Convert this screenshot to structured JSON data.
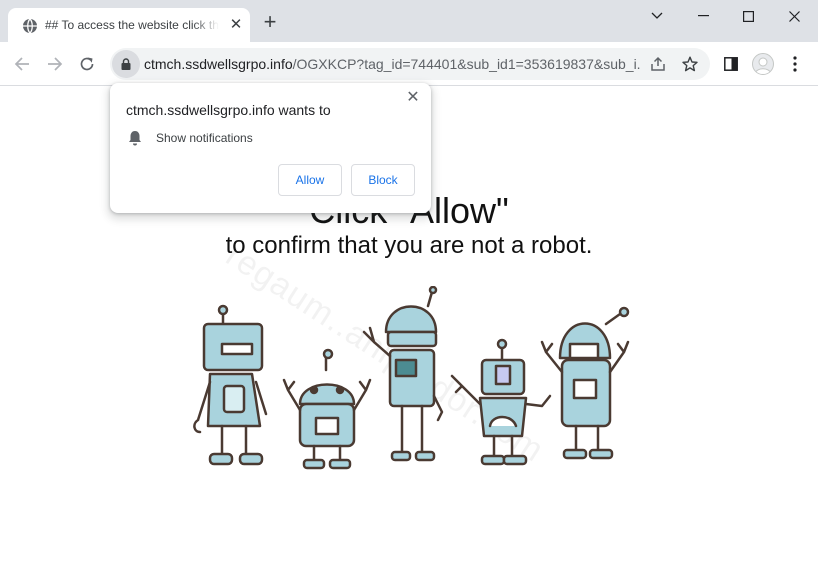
{
  "browser": {
    "tab": {
      "title": "## To access the website click the \"Allow\" button"
    },
    "new_tab_label": "+",
    "tab_close_label": "✕",
    "url": {
      "host": "ctmch.ssdwellsgrpo.info",
      "path": "/OGXKCP?tag_id=744401&sub_id1=353619837&sub_i..."
    }
  },
  "page": {
    "heading": "Click \"Allow\"",
    "subheading": "to confirm that you are not a robot.",
    "watermark": "regaum..aniprador.com"
  },
  "prompt": {
    "title": "ctmch.ssdwellsgrpo.info wants to",
    "permission": "Show notifications",
    "allow_label": "Allow",
    "block_label": "Block",
    "close_label": "✕"
  },
  "colors": {
    "tabstrip": "#dee1e6",
    "accent": "#1a73e8",
    "robot_fill": "#a9d3dd",
    "robot_outline": "#4a3a32"
  },
  "icons": [
    "globe-icon",
    "close-icon",
    "plus-icon",
    "chevron-down-icon",
    "minimize-icon",
    "maximize-icon",
    "window-close-icon",
    "back-arrow-icon",
    "forward-arrow-icon",
    "reload-icon",
    "lock-icon",
    "share-icon",
    "star-icon",
    "side-panel-icon",
    "profile-icon",
    "more-vert-icon",
    "bell-icon"
  ]
}
